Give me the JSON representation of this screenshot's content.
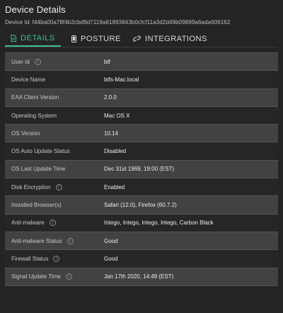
{
  "title": "Device Details",
  "device_id": "Device Id: f44ba00a78f4b2cbd9d7119a61893843b0cfcf11a3d2d49b09899a6ada606162",
  "tabs": [
    {
      "label": "DETAILS",
      "icon": "document-icon",
      "active": true
    },
    {
      "label": "POSTURE",
      "icon": "phone-icon",
      "active": false
    },
    {
      "label": "INTEGRATIONS",
      "icon": "link-icon",
      "active": false
    }
  ],
  "colors": {
    "accent": "#3fbf90",
    "background": "#242424",
    "row_alt": "#424242"
  },
  "rows": [
    {
      "label": "User Id",
      "value": "btf",
      "info": true
    },
    {
      "label": "Device Name",
      "value": "btfs-Mac.local",
      "info": false
    },
    {
      "label": "EAA Client Version",
      "value": "2.0.0",
      "info": false
    },
    {
      "label": "Operating System",
      "value": "Mac OS X",
      "info": false
    },
    {
      "label": "OS Version",
      "value": "10.14",
      "info": false
    },
    {
      "label": "OS Auto Update Status",
      "value": "Disabled",
      "info": false
    },
    {
      "label": "OS Last Update Time",
      "value": "Dec 31st 1969, 19:00 (EST)",
      "info": false
    },
    {
      "label": "Disk Encryption",
      "value": "Enabled",
      "info": true
    },
    {
      "label": "Installed Browser(s)",
      "value": "Safari (12.0), Firefox (60.7.2)",
      "info": false
    },
    {
      "label": "Anti-malware",
      "value": "Intego, Intego, Intego, Intego, Carbon Black",
      "info": true
    },
    {
      "label": "Anti-malware Status",
      "value": "Good",
      "info": true
    },
    {
      "label": "Firewall Status",
      "value": "Good",
      "info": true
    },
    {
      "label": "Signal Update Time",
      "value": "Jan 17th 2020, 14:49 (EST)",
      "info": true
    }
  ]
}
